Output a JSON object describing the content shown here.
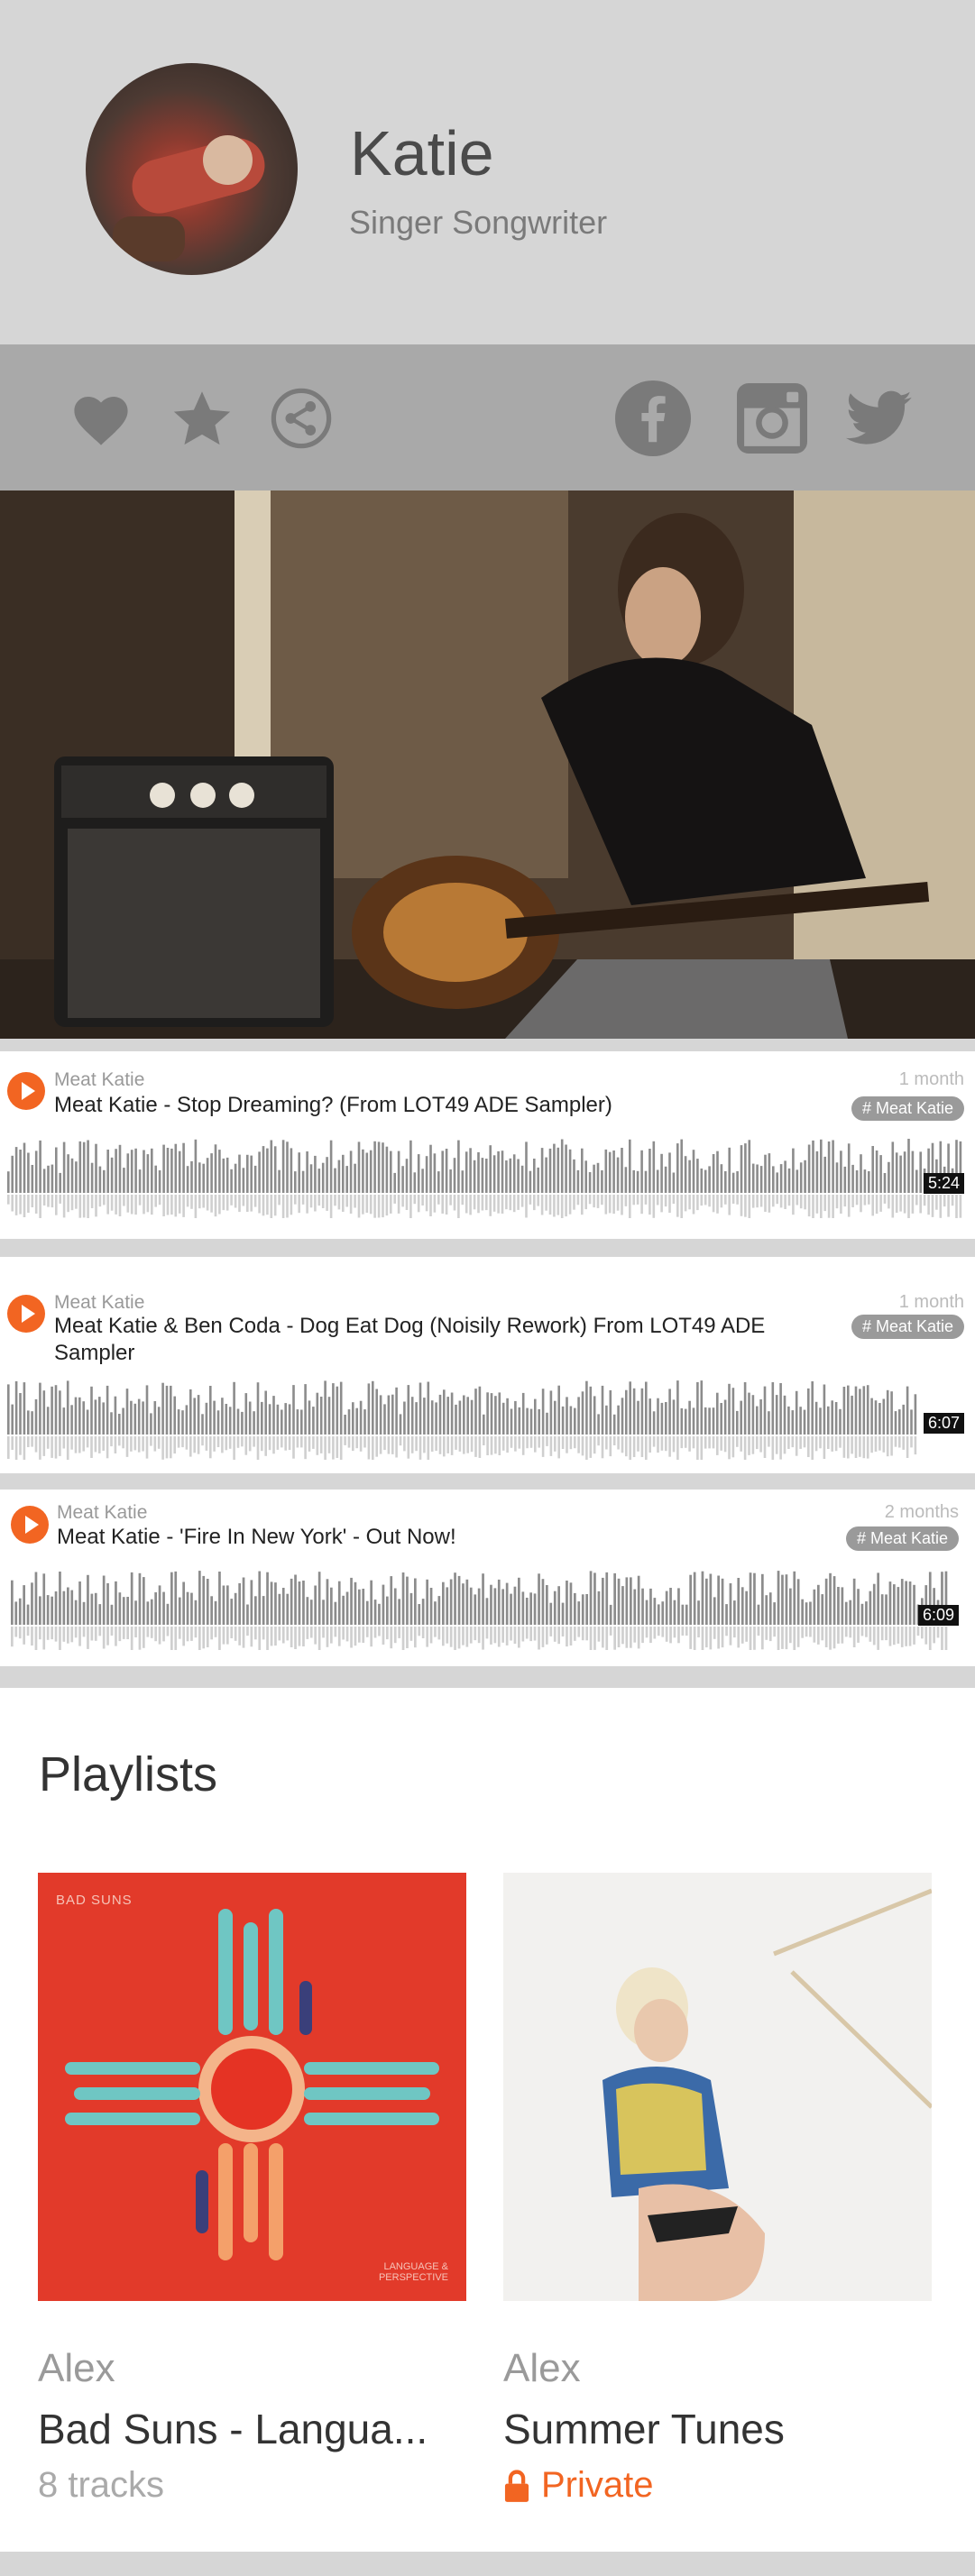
{
  "profile": {
    "name": "Katie",
    "subtitle": "Singer Songwriter"
  },
  "actions": {
    "left": [
      "heart-icon",
      "star-icon",
      "share-icon"
    ],
    "right": [
      "facebook-icon",
      "instagram-icon",
      "twitter-icon"
    ]
  },
  "tracks": [
    {
      "artist": "Meat Katie",
      "title": "Meat Katie - Stop Dreaming? (From LOT49 ADE Sampler)",
      "age": "1 month",
      "tag": "# Meat Katie",
      "duration": "5:24"
    },
    {
      "artist": "Meat Katie",
      "title": "Meat Katie & Ben Coda - Dog Eat Dog (Noisily Rework) From LOT49 ADE Sampler",
      "age": "1 month",
      "tag": "# Meat Katie",
      "duration": "6:07"
    },
    {
      "artist": "Meat Katie",
      "title": "Meat Katie - 'Fire In New York' - Out Now!",
      "age": "2 months",
      "tag": "# Meat Katie",
      "duration": "6:09"
    }
  ],
  "playlists": {
    "heading": "Playlists",
    "items": [
      {
        "user": "Alex",
        "title": "Bad Suns - Langua...",
        "meta": "8 tracks",
        "cover_text_top": "BAD SUNS",
        "cover_text_bottom": "LANGUAGE & PERSPECTIVE"
      },
      {
        "user": "Alex",
        "title": "Summer Tunes",
        "meta": "Private"
      }
    ]
  },
  "colors": {
    "accent": "#f26522",
    "background": "#d6d6d6",
    "actionbar": "#a9a9a9"
  }
}
